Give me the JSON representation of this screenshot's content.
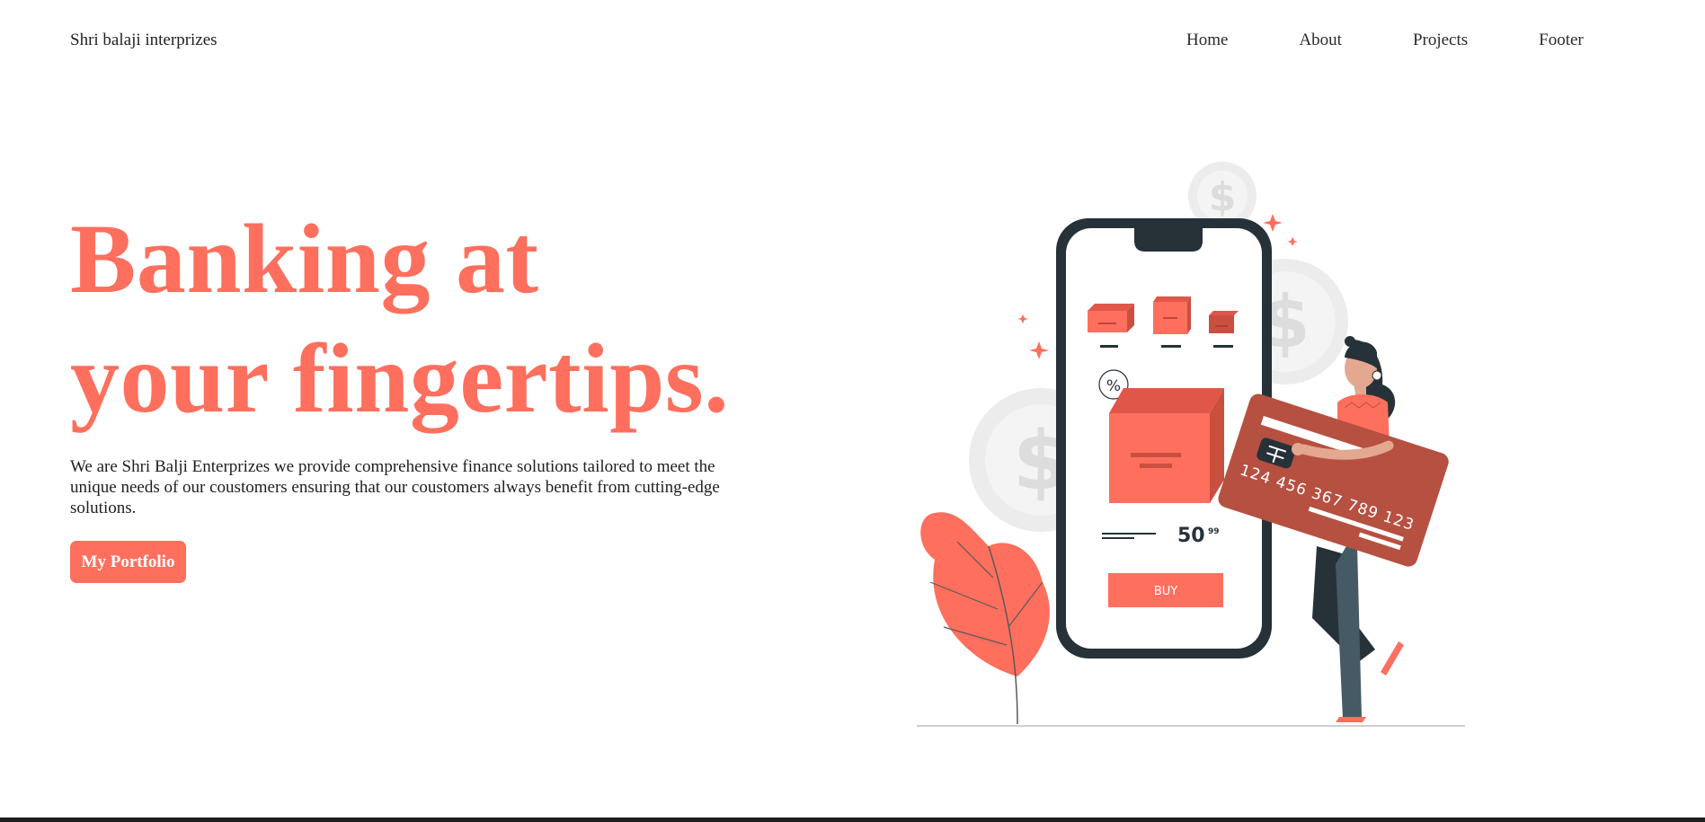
{
  "header": {
    "brand": "Shri balaji interprizes",
    "nav": [
      {
        "label": "Home"
      },
      {
        "label": "About"
      },
      {
        "label": "Projects"
      },
      {
        "label": "Footer"
      }
    ]
  },
  "hero": {
    "title_line1": "Banking at",
    "title_line2": "your fingertips.",
    "description": "We are Shri Balji Enterprizes we provide comprehensive finance solutions tailored to meet the unique needs of our coustomers ensuring that our coustomers always benefit from cutting-edge solutions.",
    "cta_label": "My Portfolio"
  },
  "illustration": {
    "price_main": "50",
    "price_cents": "99",
    "buy_label": "BUY",
    "percent_symbol": "%",
    "card_number": "124 456 367 789 123",
    "dollar_symbol": "$"
  },
  "colors": {
    "accent": "#fe6f5e",
    "accent_dark": "#b65041",
    "phone_frame": "#263238",
    "coin": "#ececec",
    "background": "#ffffff"
  }
}
